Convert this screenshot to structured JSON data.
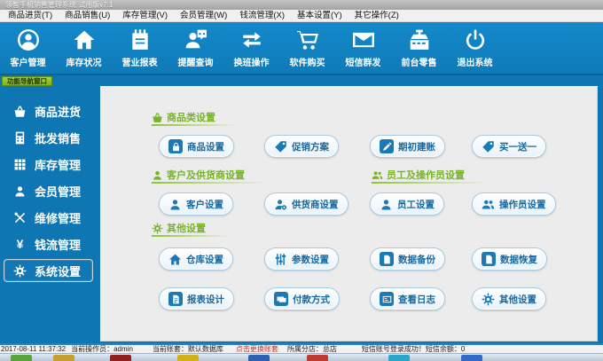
{
  "window": {
    "title": "领智手机销售管理系统 试用版v7.1"
  },
  "menu": {
    "items": [
      {
        "label": "商品进货(T)"
      },
      {
        "label": "商品销售(U)"
      },
      {
        "label": "库存管理(V)"
      },
      {
        "label": "会员管理(W)"
      },
      {
        "label": "钱流管理(X)"
      },
      {
        "label": "基本设置(Y)"
      },
      {
        "label": "其它操作(Z)"
      }
    ]
  },
  "toolbar": {
    "items": [
      {
        "icon": "user-circle-icon",
        "label": "客户管理"
      },
      {
        "icon": "house-icon",
        "label": "库存状况"
      },
      {
        "icon": "notebook-icon",
        "label": "营业报表"
      },
      {
        "icon": "chat-person-icon",
        "label": "提醒查询"
      },
      {
        "icon": "swap-arrows-icon",
        "label": "换班操作"
      },
      {
        "icon": "cart-icon",
        "label": "软件购买"
      },
      {
        "icon": "mail-icon",
        "label": "短信群发"
      },
      {
        "icon": "register-icon",
        "label": "前台零售"
      },
      {
        "icon": "power-icon",
        "label": "退出系统"
      }
    ]
  },
  "nav_tab": {
    "label": "功能导航窗口"
  },
  "sidebar": {
    "items": [
      {
        "icon": "basket-icon",
        "label": "商品进货",
        "selected": false
      },
      {
        "icon": "calculator-icon",
        "label": "批发销售",
        "selected": false
      },
      {
        "icon": "grid-icon",
        "label": "库存管理",
        "selected": false
      },
      {
        "icon": "person-icon",
        "label": "会员管理",
        "selected": false
      },
      {
        "icon": "tools-icon",
        "label": "维修管理",
        "selected": false
      },
      {
        "icon": "yen-icon",
        "glyph": "¥",
        "label": "钱流管理",
        "selected": false
      },
      {
        "icon": "gear-icon",
        "label": "系统设置",
        "selected": true
      }
    ]
  },
  "main": {
    "sections": [
      {
        "title": "商品类设置",
        "icon": "basket-icon",
        "buttons": [
          {
            "icon": "lock-icon",
            "label": "商品设置"
          },
          {
            "icon": "tag-icon",
            "label": "促销方案"
          },
          {
            "icon": "pencil-icon",
            "label": "期初建账"
          },
          {
            "icon": "tag-icon",
            "label": "买一送一"
          }
        ]
      },
      {
        "title": "客户及供货商设置",
        "icon": "person-icon",
        "buttons": [
          {
            "icon": "person-icon",
            "label": "客户设置"
          },
          {
            "icon": "person-gear-icon",
            "label": "供货商设置"
          }
        ]
      },
      {
        "title": "员工及操作员设置",
        "icon": "people-icon",
        "buttons": [
          {
            "icon": "person-icon",
            "label": "员工设置"
          },
          {
            "icon": "people-icon",
            "label": "操作员设置"
          }
        ]
      },
      {
        "title": "其他设置",
        "icon": "gear-icon",
        "buttons": [
          {
            "icon": "house-icon",
            "label": "仓库设置"
          },
          {
            "icon": "sliders-icon",
            "label": "参数设置"
          },
          {
            "icon": "doc-icon",
            "label": "数据备份"
          },
          {
            "icon": "doc-icon",
            "label": "数据恢复"
          },
          {
            "icon": "report-icon",
            "label": "报表设计"
          },
          {
            "icon": "card-icon",
            "label": "付款方式"
          },
          {
            "icon": "log-icon",
            "label": "查看日志"
          },
          {
            "icon": "gear-icon",
            "label": "其他设置"
          }
        ]
      }
    ]
  },
  "status_bar": {
    "timestamp": "2017-08-11 11:37:32",
    "operator": "当前操作员：admin",
    "account": "当前账套：默认数据库",
    "switch_account_link": "点击更换账套",
    "branch": "所属分店：总店",
    "sms": "短信账号登录成功！短信余额：0"
  },
  "taskbar": {
    "styles": [
      "left:12px;background:#58a33a",
      "left:60px;background:#c79f2f",
      "left:124px;background:#8e2020",
      "left:200px;background:#d3b218",
      "left:280px;background:#2f5fb0",
      "left:346px;background:#bf3b2f",
      "left:438px;background:#28a7c9",
      "left:520px;background:#3468c8"
    ]
  },
  "colors": {
    "toolbar_blue": "#1081c1",
    "sidebar_blue": "#0e76b2",
    "section_green": "#76b526",
    "button_text_blue": "#17699f",
    "button_icon_blue": "#1b79b5",
    "nav_tab_green": "#8fc320",
    "switch_link_red": "#c0392b"
  }
}
